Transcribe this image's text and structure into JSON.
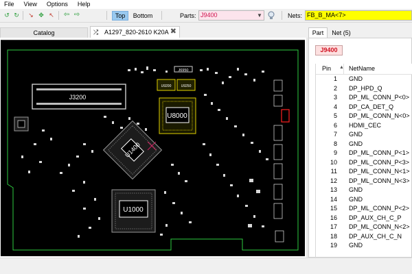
{
  "menu": [
    "File",
    "View",
    "Options",
    "Help"
  ],
  "toolbar": {
    "top_label": "Top",
    "bottom_label": "Bottom",
    "parts_label": "Parts:",
    "parts_value": "J9400",
    "nets_label": "Nets:",
    "nets_value": "FB_B_MA<7>"
  },
  "tabs": {
    "catalog": "Catalog",
    "board": "A1297_820-2610 K20A"
  },
  "board": {
    "labels": {
      "j3200": "J3200",
      "u8000": "U8000",
      "u1400": "U1400",
      "u1000": "U1000",
      "j6950": "J6950",
      "u9200": "U9200",
      "u9250": "U9250"
    }
  },
  "right_panel": {
    "tab_part": "Part",
    "tab_net": "Net (5)",
    "part_name": "J9400",
    "col_pin": "Pin",
    "col_netname": "NetName",
    "rows": [
      {
        "pin": "1",
        "net": "GND"
      },
      {
        "pin": "2",
        "net": "DP_HPD_Q"
      },
      {
        "pin": "3",
        "net": "DP_ML_CONN_P<0>"
      },
      {
        "pin": "4",
        "net": "DP_CA_DET_Q"
      },
      {
        "pin": "5",
        "net": "DP_ML_CONN_N<0>"
      },
      {
        "pin": "6",
        "net": "HDMI_CEC"
      },
      {
        "pin": "7",
        "net": "GND"
      },
      {
        "pin": "8",
        "net": "GND"
      },
      {
        "pin": "9",
        "net": "DP_ML_CONN_P<1>"
      },
      {
        "pin": "10",
        "net": "DP_ML_CONN_P<3>"
      },
      {
        "pin": "11",
        "net": "DP_ML_CONN_N<1>"
      },
      {
        "pin": "12",
        "net": "DP_ML_CONN_N<3>"
      },
      {
        "pin": "13",
        "net": "GND"
      },
      {
        "pin": "14",
        "net": "GND"
      },
      {
        "pin": "15",
        "net": "DP_ML_CONN_P<2>"
      },
      {
        "pin": "16",
        "net": "DP_AUX_CH_C_P"
      },
      {
        "pin": "17",
        "net": "DP_ML_CONN_N<2>"
      },
      {
        "pin": "18",
        "net": "DP_AUX_CH_C_N"
      },
      {
        "pin": "19",
        "net": "GND"
      }
    ]
  },
  "colors": {
    "board_bg": "#000000",
    "outline": "#2ecc40",
    "highlight_part": "#ff2020",
    "selected_net": "#ffff00",
    "tab_active": "#99c9ef"
  }
}
